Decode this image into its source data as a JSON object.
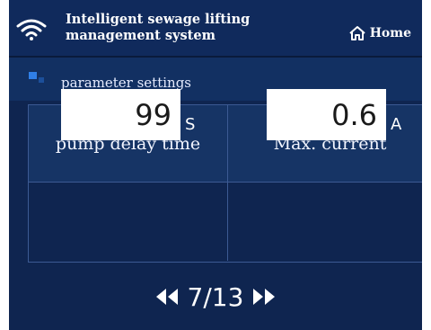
{
  "header": {
    "title_line1": "Intelligent sewage lifting",
    "title_line2": "management system",
    "home_label": "Home",
    "icons": {
      "wifi": "wifi-icon",
      "home": "home-icon"
    }
  },
  "section": {
    "label": "parameter settings",
    "icon": "settings-square-icon"
  },
  "params": [
    {
      "label": "pump delay time",
      "value": "99",
      "unit": "S"
    },
    {
      "label": "Max. current",
      "value": "0.6",
      "unit": "A"
    }
  ],
  "pager": {
    "text": "7/13",
    "icons": {
      "prev": "double-chevron-left-icon",
      "next": "double-chevron-right-icon"
    }
  },
  "colors": {
    "background": "#0f2550",
    "topbar": "#102a5c",
    "grid_line": "#3c5a93",
    "text": "#ffffff"
  }
}
